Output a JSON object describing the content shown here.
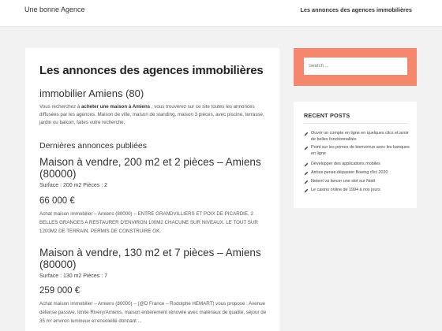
{
  "header": {
    "site_title": "Une bonne Agence",
    "nav_link": "Les annonces des agences immobilières"
  },
  "main": {
    "page_title": "Les annonces des agences immobilières",
    "city_heading": "immobilier Amiens (80)",
    "intro_before": "Vous recherchez à",
    "intro_bold": "acheter une maison à Amiens",
    "intro_after": ", vous trouverez sur ce site toutes les annonces diffusées par les agences. Maison de ville, maison de standing, maison 3 pièces, avec piscine, terrasse, jardin ou balcon, faites votre recherche.",
    "latest_heading": "Dernières annonces publiées",
    "listings": [
      {
        "title": "Maison à vendre, 200 m2 et 2 pièces – Amiens (80000)",
        "surface": "Surface : 200 m2 Pièces : 2",
        "price": "66 000 €",
        "description": "Achat maison immobilier – Amiens (80000) – ENTRE GRANDVILLIERS ET POIX DE PICARDIE, 2 BELLES GRANGES A RESTAURER D'ENVIRON 100M2 CHACUNE SUR NIVEAUX. LE TOUT SUR 1200M2 DE TERRAIN. PERMIS DE CONSTRUIRE OK."
      },
      {
        "title": "Maison à vendre, 130 m2 et 7 pièces – Amiens (80000)",
        "surface": "Surface : 130 m2 Pièces : 7",
        "price": "259 000 €",
        "description": "Achat maison immobilier – Amiens (80000) – (@D France – Rodolphe HEMART) vous propose : Avenue défense passive, limite Rivery/Amiens, maison entièrement rénovée avec matériaux de qualité, séjour de 35 m² environ lumineux et ensoleillé donnant ..."
      }
    ]
  },
  "sidebar": {
    "search_placeholder": "Search ...",
    "recent_heading": "RECENT POSTS",
    "posts": [
      "Ouvrir un compte en ligne en quelques clics et avoir de belles fonctionnalités",
      "Point sur les primes de bienvenue avec les banques en ligne",
      "Développer des applications mobiles",
      "Airbus pense dépasser Boeing d'ici 2020",
      "Netent va lancer une slot sur Noël",
      "Le casino online de 1994 à nos jours"
    ],
    "accent_color": "#f5876c"
  }
}
